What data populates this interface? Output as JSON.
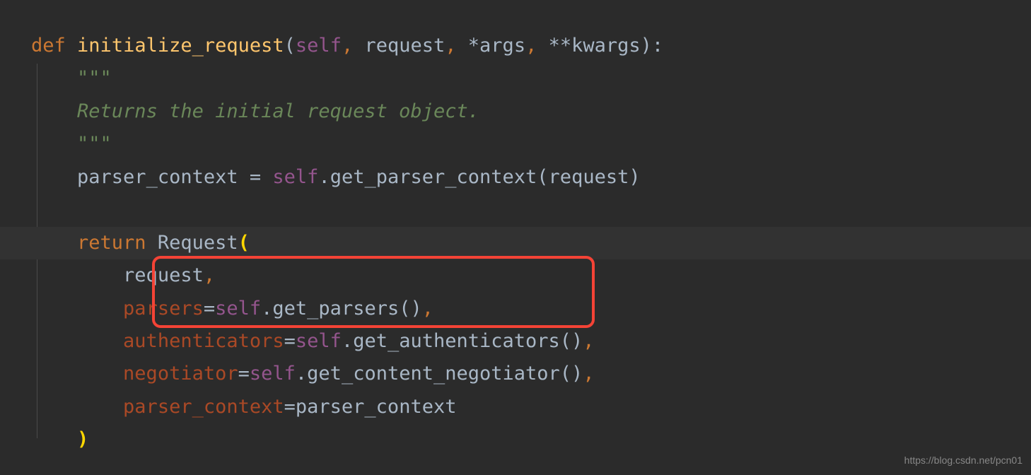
{
  "code": {
    "line1": {
      "def": "def",
      "space1": " ",
      "func": "initialize_request",
      "lparen": "(",
      "self": "self",
      "comma1": ", ",
      "param1": "request",
      "comma2": ", ",
      "star1": "*",
      "param2": "args",
      "comma3": ", ",
      "star2": "**",
      "param3": "kwargs",
      "rparen": ")",
      "colon": ":"
    },
    "line2": {
      "indent": "    ",
      "quotes": "\"\"\""
    },
    "line3": {
      "indent": "    ",
      "text": "Returns the initial request object."
    },
    "line4": {
      "indent": "    ",
      "quotes": "\"\"\""
    },
    "line5": {
      "indent": "    ",
      "var": "parser_context ",
      "eq": "=",
      "space": " ",
      "self": "self",
      "dot": ".",
      "method": "get_parser_context(request)"
    },
    "line6": {
      "indent": "    ",
      "return": "return",
      "space": " ",
      "class": "Request",
      "lparen": "("
    },
    "line7": {
      "indent": "        ",
      "text": "request",
      "comma": ","
    },
    "line8": {
      "indent": "        ",
      "kwarg": "parsers",
      "eq": "=",
      "self": "self",
      "dot": ".",
      "method": "get_parsers()",
      "comma": ","
    },
    "line9": {
      "indent": "        ",
      "kwarg": "authenticators",
      "eq": "=",
      "self": "self",
      "dot": ".",
      "method": "get_authenticators()",
      "comma": ","
    },
    "line10": {
      "indent": "        ",
      "kwarg": "negotiator",
      "eq": "=",
      "self": "self",
      "dot": ".",
      "method": "get_content_negotiator()",
      "comma": ","
    },
    "line11": {
      "indent": "        ",
      "kwarg": "parser_context",
      "eq": "=",
      "val": "parser_context"
    },
    "line12": {
      "indent": "    ",
      "rparen": ")"
    }
  },
  "watermark": "https://blog.csdn.net/pcn01"
}
